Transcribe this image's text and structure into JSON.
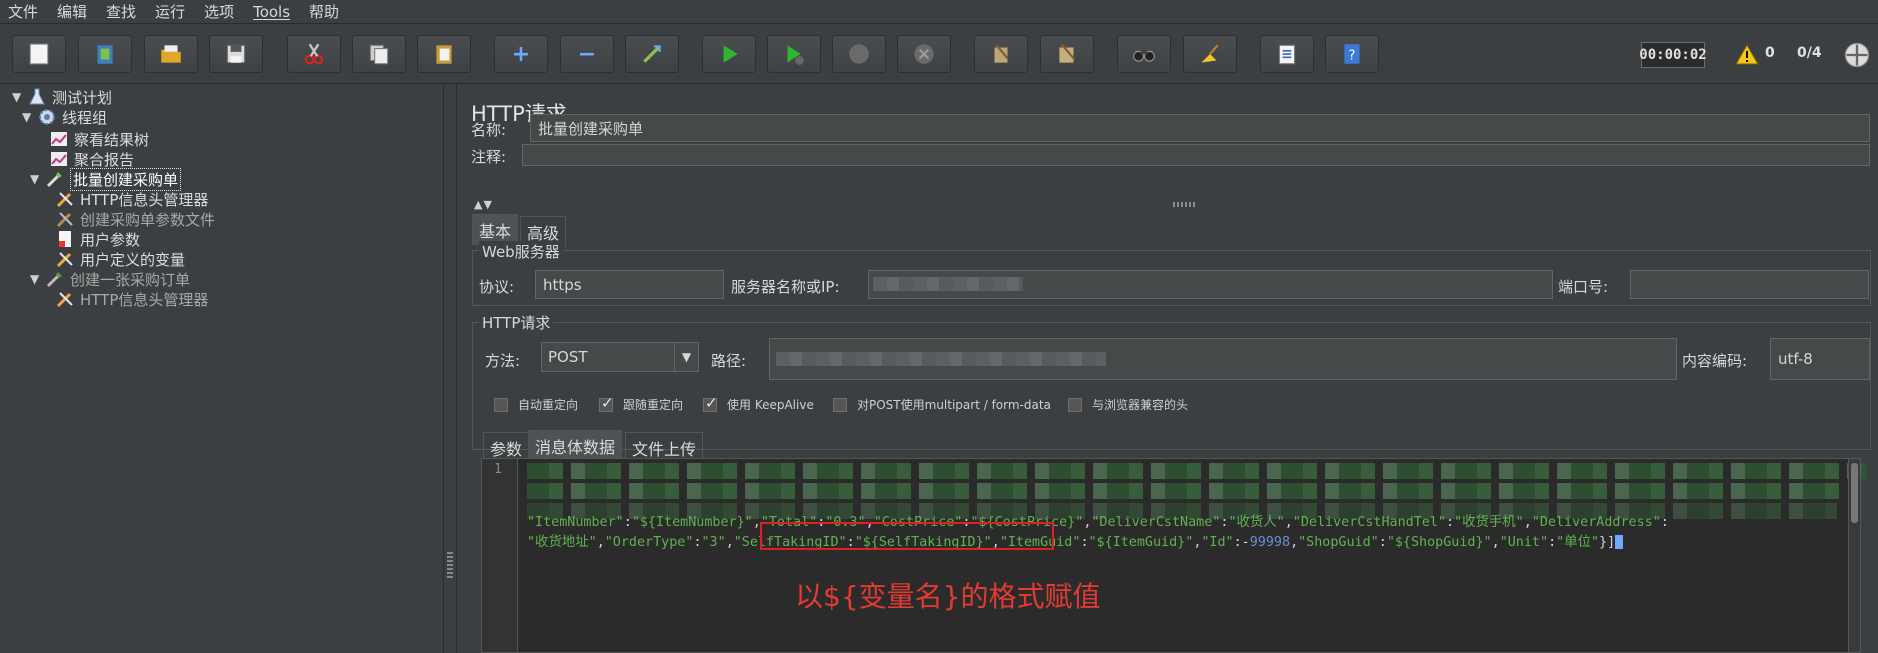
{
  "menu": [
    "文件",
    "编辑",
    "查找",
    "运行",
    "选项",
    "Tools",
    "帮助"
  ],
  "toolbar": {
    "timer": "00:00:02",
    "warnings": "0",
    "threads": "0/4"
  },
  "tree": {
    "test_plan": "测试计划",
    "thread_group": "线程组",
    "result_tree": "察看结果树",
    "aggregate_report": "聚合报告",
    "batch_create": "批量创建采购单",
    "http_header_mgr_1": "HTTP信息头管理器",
    "csv_param_file": "创建采购单参数文件",
    "user_params": "用户参数",
    "user_vars": "用户定义的变量",
    "create_order": "创建一张采购订单",
    "http_header_mgr_2": "HTTP信息头管理器"
  },
  "panel": {
    "title": "HTTP请求",
    "name_label": "名称:",
    "name_value": "批量创建采购单",
    "comment_label": "注释:",
    "tabs": [
      "基本",
      "高级"
    ],
    "web_server": {
      "title": "Web服务器",
      "protocol_label": "协议:",
      "protocol_value": "https",
      "server_label": "服务器名称或IP:",
      "port_label": "端口号:"
    },
    "http_request": {
      "title": "HTTP请求",
      "method_label": "方法:",
      "method_value": "POST",
      "path_label": "路径:",
      "encoding_label": "内容编码:",
      "encoding_value": "utf-8"
    },
    "checkboxes": [
      {
        "label": "自动重定向",
        "checked": false
      },
      {
        "label": "跟随重定向",
        "checked": true
      },
      {
        "label": "使用 KeepAlive",
        "checked": true
      },
      {
        "label": "对POST使用multipart / form-data",
        "checked": false
      },
      {
        "label": "与浏览器兼容的头",
        "checked": false
      }
    ],
    "subtabs": [
      "参数",
      "消息体数据",
      "文件上传"
    ]
  },
  "editor": {
    "line_number": "1",
    "line3": {
      "t01": "\"ItemNumber\"",
      "t02": ":",
      "t03": "\"${ItemNumber}\"",
      "t04": ",",
      "t05": "\"Total\"",
      "t06": ":",
      "t07": "\"0.3\"",
      "t08": ",",
      "t09": "\"CostPrice\"",
      "t10": ":",
      "t11": "\"${CostPrice}\"",
      "t12": ",",
      "t13": "\"DeliverCstName\"",
      "t14": ":",
      "t15": "\"收货人\"",
      "t16": ",",
      "t17": "\"DeliverCstHandTel\"",
      "t18": ":",
      "t19": "\"收货手机\"",
      "t20": ",",
      "t21": "\"DeliverAddress\"",
      "t22": ":"
    },
    "line4": {
      "t01": "\"收货地址\"",
      "t02": ",",
      "t03": "\"OrderType\"",
      "t04": ":",
      "t05": "\"3\"",
      "t06": ",",
      "t07": "\"SelfTakingID\"",
      "t08": ":",
      "t09": "\"${SelfTakingID}\"",
      "t10": ",",
      "t11": "\"ItemGuid\"",
      "t12": ":",
      "t13": "\"${ItemGuid}\"",
      "t14": ",",
      "t15": "\"Id\"",
      "t16": ":-",
      "t17": "99998",
      "t18": ",",
      "t19": "\"ShopGuid\"",
      "t20": ":",
      "t21": "\"${ShopGuid}\"",
      "t22": ",",
      "t23": "\"Unit\"",
      "t24": ":",
      "t25": "\"单位\"",
      "t26": "}]"
    },
    "annotation": "以${变量名}的格式赋值"
  },
  "colors": {
    "selection": "#4b6eaf",
    "string": "#5fb34f",
    "number": "#6b8fd6",
    "annotation": "#e23b33"
  }
}
